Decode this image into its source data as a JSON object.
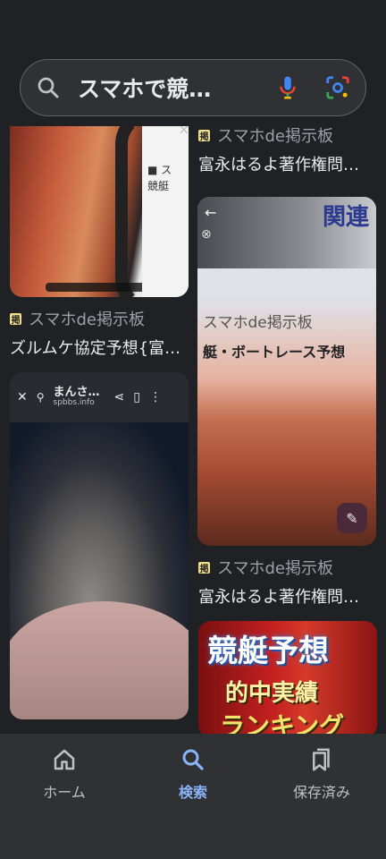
{
  "search": {
    "query": "スマホで競…"
  },
  "results": [
    {
      "source": "スマホde掲示板",
      "title": "ズルムケ協定予想{富…",
      "favicon_char": "掲"
    },
    {
      "source": "スマホde掲示板",
      "title": "富永はるよ著作権問…",
      "favicon_char": "掲"
    },
    {
      "source": "スマホde掲示板",
      "title": "富永はるよ著作権問…",
      "favicon_char": "掲"
    }
  ],
  "tile_texts": {
    "tile2_header": "関連",
    "tile2_line1": "スマホde掲示板",
    "tile2_line2": "艇・ボートレース予想",
    "tile3_site": "まんさ…",
    "tile3_domain": "spbbs.info",
    "tile4_line1": "競艇予想",
    "tile4_line2": "的中実績",
    "tile4_line3": "ランキング"
  },
  "nav": {
    "items": [
      {
        "label": "ホーム",
        "icon": "home-icon",
        "active": false
      },
      {
        "label": "検索",
        "icon": "search-icon",
        "active": true
      },
      {
        "label": "保存済み",
        "icon": "saved-icon",
        "active": false
      }
    ]
  },
  "colors": {
    "background": "#202124",
    "search_bar": "#303134",
    "accent": "#8ab4f8",
    "text": "#e8eaed",
    "muted": "#9aa0a6"
  }
}
